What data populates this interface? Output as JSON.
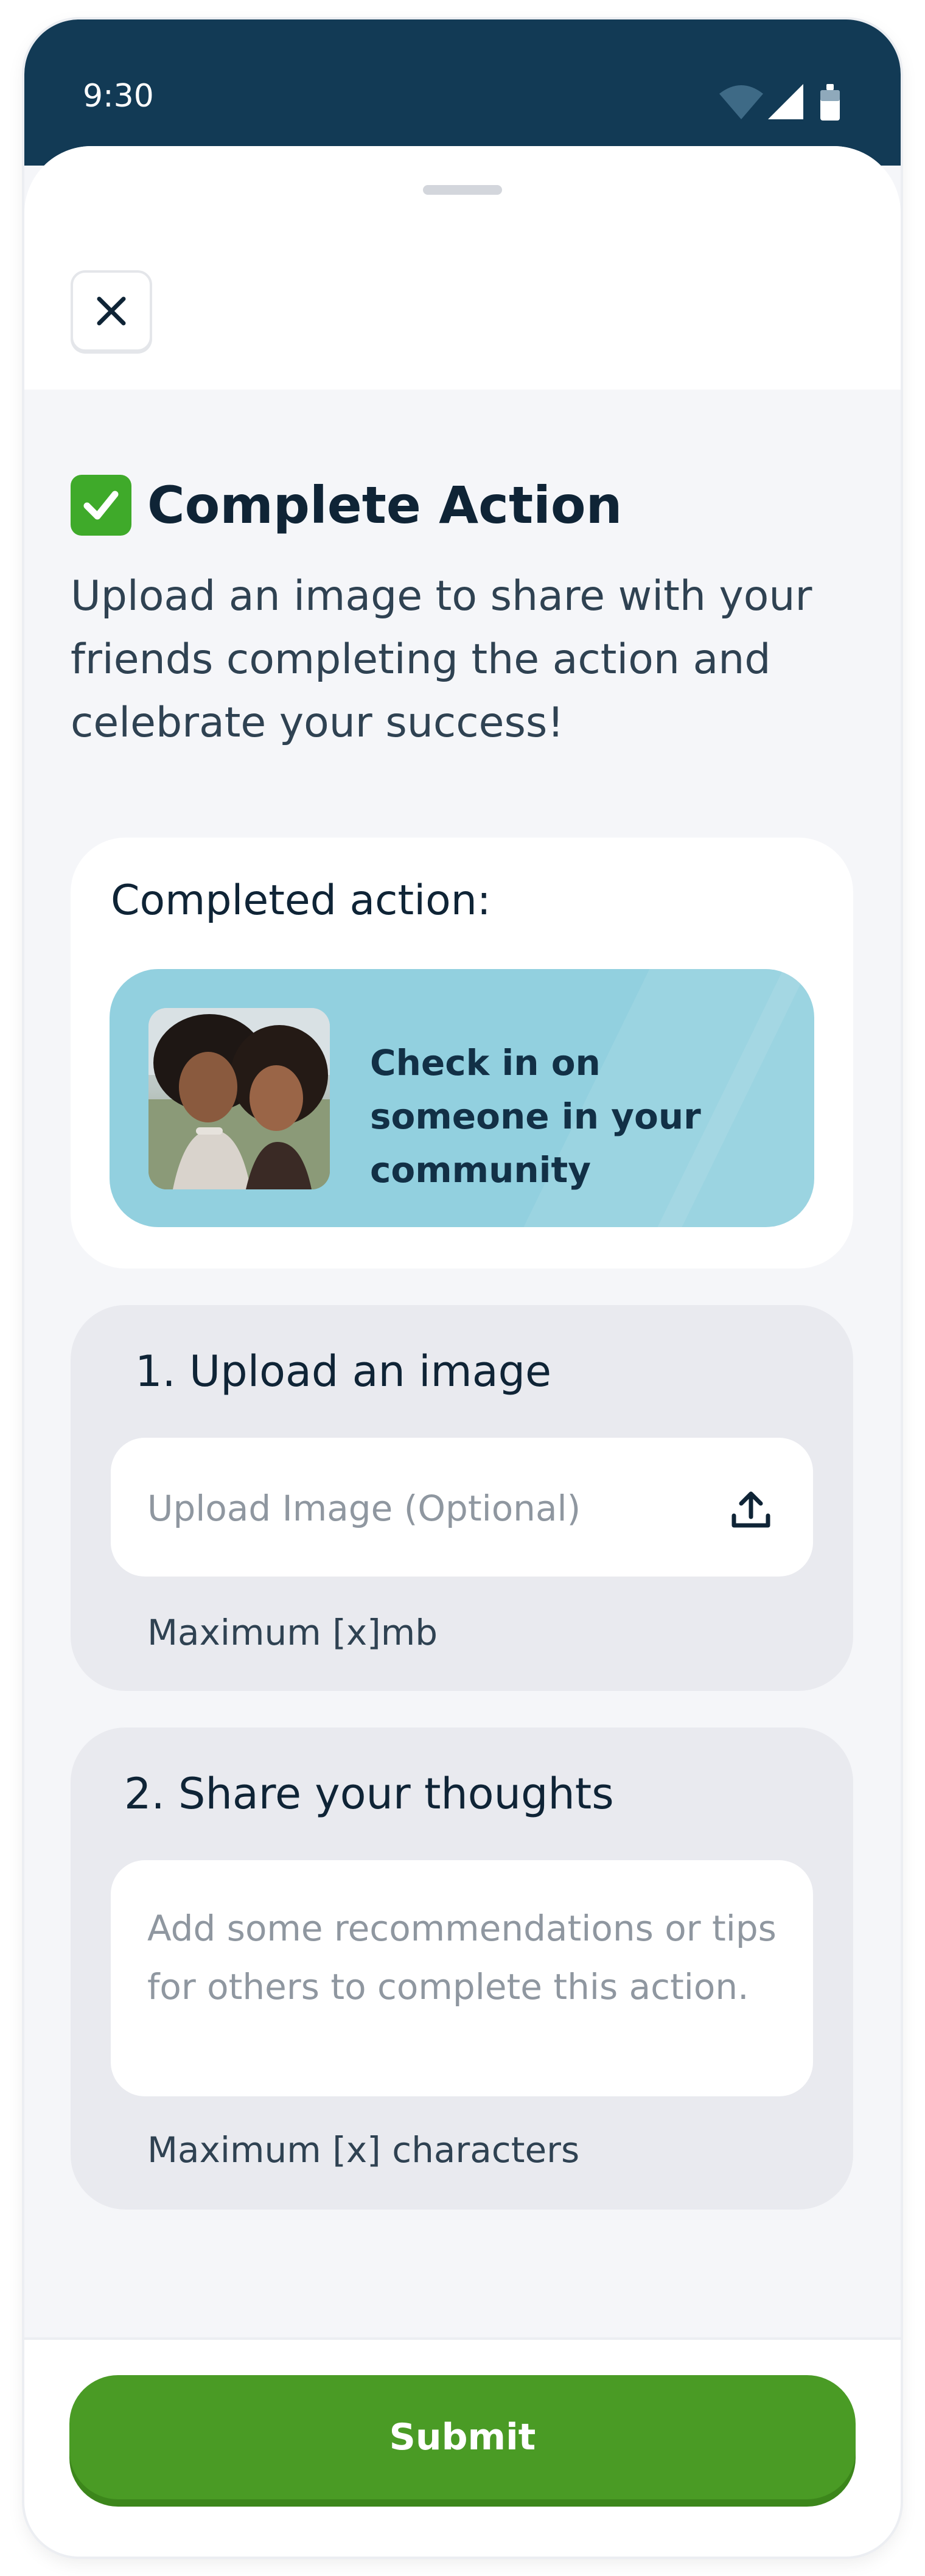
{
  "status_bar": {
    "time": "9:30"
  },
  "sheet": {
    "title": "Complete Action",
    "subtitle": "Upload an image to share with your friends completing the action and celebrate your success!"
  },
  "completed_action": {
    "heading": "Completed action:",
    "action_title": "Check in on someone in your community"
  },
  "upload_section": {
    "title": "1. Upload an image",
    "placeholder": "Upload Image (Optional)",
    "hint": "Maximum [x]mb"
  },
  "thoughts_section": {
    "title": "2. Share your thoughts",
    "placeholder": "Add some recommendations or tips for others to complete this action.",
    "hint": "Maximum [x] characters"
  },
  "footer": {
    "submit_label": "Submit"
  },
  "colors": {
    "status_bar_bg": "#123a55",
    "action_tile_bg": "#92d0df",
    "submit_bg": "#4a9b25",
    "check_icon_bg": "#3faa2a",
    "card_grey": "#e9eaef"
  },
  "icons": {
    "close": "close-icon",
    "check": "check-mark-icon",
    "upload": "upload-icon",
    "wifi": "wifi-icon",
    "signal": "signal-icon",
    "battery": "battery-icon"
  }
}
